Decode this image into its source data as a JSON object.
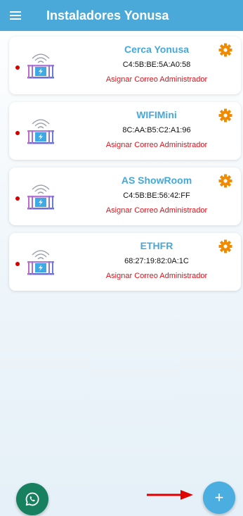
{
  "app_bar": {
    "title": "Instaladores Yonusa",
    "menu_icon": "hamburger-menu-icon"
  },
  "devices": [
    {
      "name": "Cerca Yonusa",
      "mac": "C4:5B:BE:5A:A0:58",
      "action": "Asignar Correo Administrador"
    },
    {
      "name": "WIFIMini",
      "mac": "8C:AA:B5:C2:A1:96",
      "action": "Asignar Correo Administrador"
    },
    {
      "name": "AS ShowRoom",
      "mac": "C4:5B:BE:56:42:FF",
      "action": "Asignar Correo Administrador"
    },
    {
      "name": "ETHFR",
      "mac": "68:27:19:82:0A:1C",
      "action": "Asignar Correo Administrador"
    }
  ],
  "fabs": {
    "add_label": "+",
    "whatsapp_icon": "whatsapp-icon"
  },
  "colors": {
    "appbar": "#4aa9d8",
    "device_name": "#46a8d9",
    "action_text": "#e0101a",
    "gear": "#f28a00",
    "status_offline": "#d40000",
    "whatsapp": "#16805f",
    "add_button": "#4aaee0",
    "annotation_arrow": "#e00000"
  }
}
